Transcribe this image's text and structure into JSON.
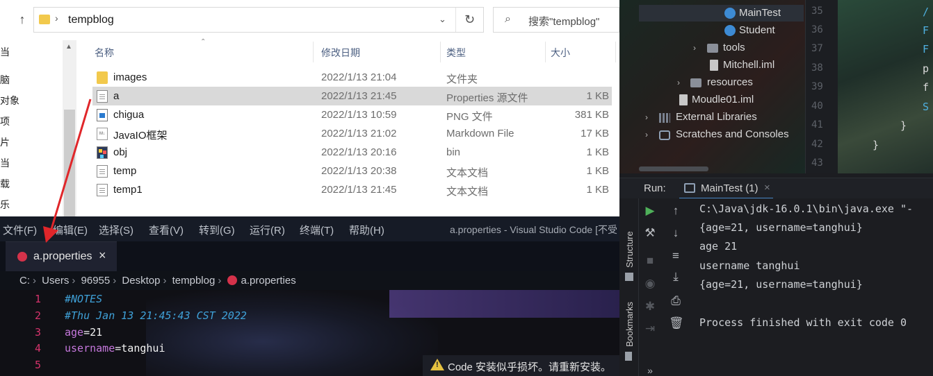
{
  "explorer": {
    "path": "tempblog",
    "search_placeholder": "搜索\"tempblog\"",
    "nav_items": [
      "当",
      "脑",
      "对象",
      "项",
      "片",
      "当",
      "载",
      "乐"
    ],
    "columns": {
      "name": "名称",
      "date": "修改日期",
      "type": "类型",
      "size": "大小"
    },
    "files": [
      {
        "name": "images",
        "date": "2022/1/13 21:04",
        "type": "文件夹",
        "size": "",
        "icon": "folder-icon"
      },
      {
        "name": "a",
        "date": "2022/1/13 21:45",
        "type": "Properties 源文件",
        "size": "1 KB",
        "icon": "text-file-icon"
      },
      {
        "name": "chigua",
        "date": "2022/1/13 10:59",
        "type": "PNG 文件",
        "size": "381 KB",
        "icon": "image-file-icon"
      },
      {
        "name": "JavaIO框架",
        "date": "2022/1/13 21:02",
        "type": "Markdown File",
        "size": "17 KB",
        "icon": "markdown-file-icon"
      },
      {
        "name": "obj",
        "date": "2022/1/13 20:16",
        "type": "bin",
        "size": "1 KB",
        "icon": "bin-file-icon"
      },
      {
        "name": "temp",
        "date": "2022/1/13 20:38",
        "type": "文本文档",
        "size": "1 KB",
        "icon": "text-file-icon"
      },
      {
        "name": "temp1",
        "date": "2022/1/13 21:45",
        "type": "文本文档",
        "size": "1 KB",
        "icon": "text-file-icon"
      }
    ]
  },
  "vscode": {
    "menu": [
      "文件(F)",
      "编辑(E)",
      "选择(S)",
      "查看(V)",
      "转到(G)",
      "运行(R)",
      "终端(T)",
      "帮助(H)"
    ],
    "window_title": "a.properties - Visual Studio Code [不受",
    "tab_label": "a.properties",
    "breadcrumb": [
      "C:",
      "Users",
      "96955",
      "Desktop",
      "tempblog",
      "a.properties"
    ],
    "line_numbers": [
      "1",
      "2",
      "3",
      "4",
      "5"
    ],
    "lines": {
      "l1": "#NOTES",
      "l2": "#Thu Jan 13 21:45:43 CST 2022",
      "l3_key": "age",
      "l3_eq": "=",
      "l3_val": "21",
      "l4_key": "username",
      "l4_eq": "=",
      "l4_val": "tanghui"
    },
    "notification": "Code 安装似乎损坏。请重新安装。"
  },
  "idea": {
    "tree": {
      "maintest": "MainTest",
      "student": "Student",
      "tools": "tools",
      "mitchell_iml": "Mitchell.iml",
      "resources": "resources",
      "moudle_iml": "Moudle01.iml",
      "external_libraries": "External Libraries",
      "scratches": "Scratches and Consoles"
    },
    "gutter_lines": [
      "35",
      "36",
      "37",
      "38",
      "39",
      "40",
      "41",
      "42",
      "43"
    ],
    "editor_fragments": {
      "a": "/",
      "b": "F",
      "c": "F",
      "d": "p",
      "e": "f",
      "f": "S",
      "g": "}",
      "h": "}"
    },
    "run": {
      "label": "Run:",
      "tab": "MainTest (1)",
      "side_labels": {
        "structure": "Structure",
        "bookmarks": "Bookmarks"
      },
      "more": "»",
      "console": [
        "C:\\Java\\jdk-16.0.1\\bin\\java.exe \"-",
        "{age=21, username=tanghui}",
        "age 21",
        "username tanghui",
        "{age=21, username=tanghui}",
        "",
        "Process finished with exit code 0"
      ]
    }
  },
  "colors": {
    "annotation_arrow": "#e0262a",
    "vscode_line_number": "#d6336c",
    "vscode_comment": "#3fa1d8",
    "vscode_key": "#c678dd",
    "run_play": "#4fb05a"
  }
}
